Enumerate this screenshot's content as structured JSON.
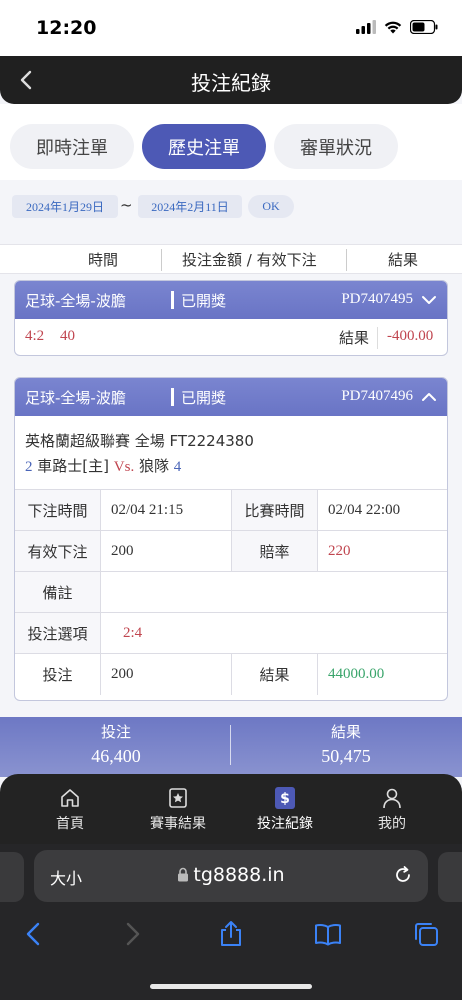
{
  "status_bar": {
    "time": "12:20"
  },
  "header": {
    "title": "投注紀錄"
  },
  "tabs": [
    {
      "label": "即時注單",
      "active": false
    },
    {
      "label": "歷史注單",
      "active": true
    },
    {
      "label": "審單狀況",
      "active": false
    }
  ],
  "date_filter": {
    "start": "2024年1月29日",
    "separator": "~",
    "end": "2024年2月11日",
    "ok_label": "OK"
  },
  "columns": {
    "time": "時間",
    "amount": "投注金額 / 有效下注",
    "result": "結果"
  },
  "bets": [
    {
      "category": "足球-全場-波膽",
      "status": "已開獎",
      "id": "PD7407495",
      "expanded": false,
      "summary_score": "4:2",
      "summary_amount": "40",
      "result_label": "結果",
      "result_value": "-400.00"
    },
    {
      "category": "足球-全場-波膽",
      "status": "已開獎",
      "id": "PD7407496",
      "expanded": true,
      "league": "英格蘭超級聯賽 全場 FT2224380",
      "home_score": "2",
      "home_team": "車路士[主]",
      "vs": "Vs.",
      "away_team": "狼隊",
      "away_score": "4",
      "details": {
        "bet_time_label": "下注時間",
        "bet_time": "02/04 21:15",
        "match_time_label": "比賽時間",
        "match_time": "02/04 22:00",
        "valid_bet_label": "有效下注",
        "valid_bet": "200",
        "odds_label": "賠率",
        "odds": "220",
        "remark_label": "備註",
        "remark": "",
        "option_label": "投注選項",
        "option": "2:4",
        "stake_label": "投注",
        "stake": "200",
        "result_label": "結果",
        "result": "44000.00"
      }
    }
  ],
  "totals": {
    "bet_label": "投注",
    "bet_value": "46,400",
    "result_label": "結果",
    "result_value": "50,475"
  },
  "bottom_nav": [
    {
      "label": "首頁",
      "icon": "home-icon"
    },
    {
      "label": "賽事結果",
      "icon": "star-bookmark-icon"
    },
    {
      "label": "投注紀錄",
      "icon": "dollar-ticket-icon",
      "active": true
    },
    {
      "label": "我的",
      "icon": "person-icon"
    }
  ],
  "browser": {
    "text_size_label": "大小",
    "url": "tg8888.in"
  },
  "colors": {
    "accent": "#4d59b5",
    "card_header": "#6974c5",
    "loss": "#c0454f",
    "win": "#3aa56b"
  }
}
